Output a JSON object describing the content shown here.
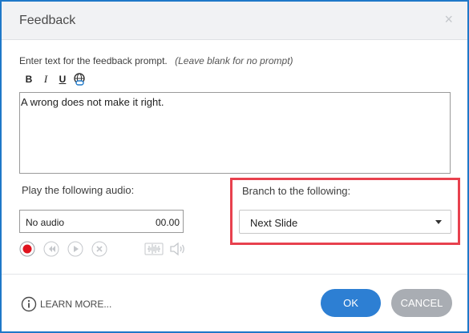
{
  "dialog": {
    "title": "Feedback",
    "close_glyph": "×"
  },
  "prompt": {
    "label": "Enter text for the feedback prompt.",
    "hint": "(Leave blank for no prompt)",
    "text": "A wrong does not make it right.",
    "format": {
      "bold": "B",
      "italic": "I",
      "underline": "U",
      "link_icon": "link-icon"
    }
  },
  "audio": {
    "label": "Play the following audio:",
    "name": "No audio",
    "time": "00.00",
    "controls": [
      "record-icon",
      "rewind-icon",
      "play-icon",
      "delete-icon",
      "waveform-icon",
      "volume-icon"
    ],
    "record_color": "#e0141f"
  },
  "branch": {
    "label": "Branch to the following:",
    "selected": "Next Slide",
    "highlight_color": "#e8414e"
  },
  "footer": {
    "learn_more": "LEARN MORE...",
    "ok": "OK",
    "cancel": "CANCEL"
  },
  "colors": {
    "accent": "#2d7fd3",
    "border": "#1f78c8",
    "cancel": "#a9adb3"
  }
}
